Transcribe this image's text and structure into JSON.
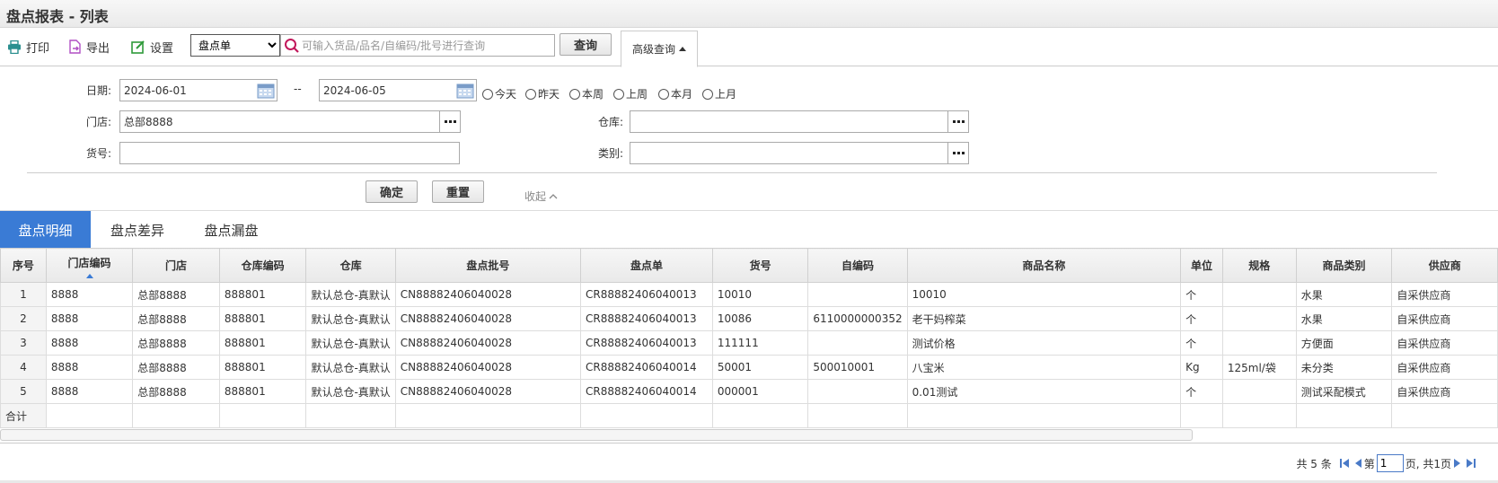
{
  "page": {
    "title": "盘点报表 - 列表"
  },
  "toolbar": {
    "print_label": "打印",
    "export_label": "导出",
    "settings_label": "设置",
    "select_value": "盘点单",
    "search_placeholder": "可输入货品/品名/自编码/批号进行查询",
    "query_label": "查询",
    "advanced_label": "高级查询"
  },
  "filter": {
    "date_label": "日期:",
    "date_from": "2024-06-01",
    "date_sep": "--",
    "date_to": "2024-06-05",
    "quick_ranges": [
      "今天",
      "昨天",
      "本周",
      "上周",
      "本月",
      "上月"
    ],
    "store_label": "门店:",
    "store_value": "总部8888",
    "warehouse_label": "仓库:",
    "warehouse_value": "",
    "sku_label": "货号:",
    "sku_value": "",
    "category_label": "类别:",
    "category_value": "",
    "confirm_label": "确定",
    "reset_label": "重置",
    "collapse_label": "收起"
  },
  "tabs": [
    "盘点明细",
    "盘点差异",
    "盘点漏盘"
  ],
  "table": {
    "columns": [
      "序号",
      "门店编码",
      "门店",
      "仓库编码",
      "仓库",
      "盘点批号",
      "盘点单",
      "货号",
      "自编码",
      "商品名称",
      "单位",
      "规格",
      "商品类别",
      "供应商"
    ],
    "rows": [
      [
        "1",
        "8888",
        "总部8888",
        "888801",
        "默认总仓-真默认",
        "CN88882406040028",
        "CR88882406040013",
        "10010",
        "",
        "10010",
        "个",
        "",
        "水果",
        "自采供应商"
      ],
      [
        "2",
        "8888",
        "总部8888",
        "888801",
        "默认总仓-真默认",
        "CN88882406040028",
        "CR88882406040013",
        "10086",
        "6110000000352",
        "老干妈榨菜",
        "个",
        "",
        "水果",
        "自采供应商"
      ],
      [
        "3",
        "8888",
        "总部8888",
        "888801",
        "默认总仓-真默认",
        "CN88882406040028",
        "CR88882406040013",
        "111111",
        "",
        "测试价格",
        "个",
        "",
        "方便面",
        "自采供应商"
      ],
      [
        "4",
        "8888",
        "总部8888",
        "888801",
        "默认总仓-真默认",
        "CN88882406040028",
        "CR88882406040014",
        "50001",
        "500010001",
        "八宝米",
        "Kg",
        "125ml/袋",
        "未分类",
        "自采供应商"
      ],
      [
        "5",
        "8888",
        "总部8888",
        "888801",
        "默认总仓-真默认",
        "CN88882406040028",
        "CR88882406040014",
        "000001",
        "",
        "0.01测试",
        "个",
        "",
        "测试采配模式",
        "自采供应商"
      ]
    ],
    "total_label": "合计"
  },
  "pager": {
    "total_text": "共 5 条",
    "page_prefix": "第",
    "current_page": "1",
    "page_suffix": "页, 共1页"
  },
  "colors": {
    "accent": "#3a7bd5"
  }
}
